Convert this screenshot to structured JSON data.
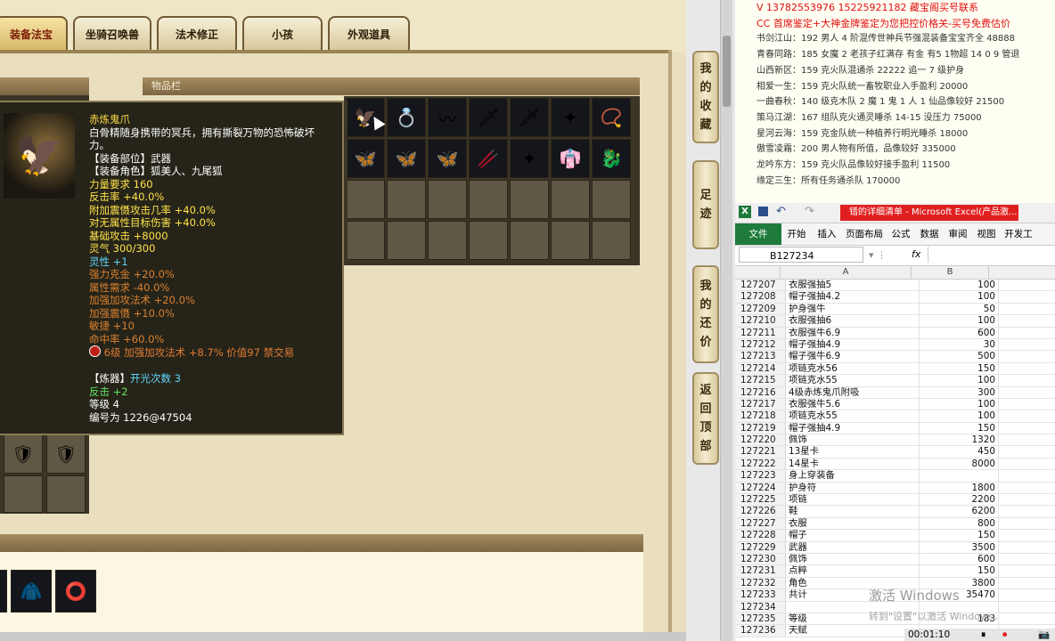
{
  "game": {
    "tabs": [
      {
        "label": "装备法宝",
        "active": true
      },
      {
        "label": "坐骑召唤兽",
        "active": false
      },
      {
        "label": "法术修正",
        "active": false
      },
      {
        "label": "小孩",
        "active": false
      },
      {
        "label": "外观道具",
        "active": false
      }
    ],
    "inventory_header": "物品栏",
    "inventory_row1_icons": [
      "🦅",
      "💍",
      "〰",
      "🗡",
      "🗡",
      "✦",
      "📿"
    ],
    "inventory_row2_icons": [
      "🦋",
      "🦋",
      "🦋",
      "🥢",
      "✦",
      "👘",
      "🐉"
    ],
    "tooltip": {
      "name": "赤炼鬼爪",
      "desc_line1": "白骨精随身携带的冥兵，拥有撕裂万物的恐怖破坏",
      "desc_line2": "力。",
      "slot": "【装备部位】武器",
      "role": "【装备角色】狐美人、九尾狐",
      "stats_yellow": [
        "力量要求 160",
        "反击率 +40.0%",
        "附加震慑攻击几率 +40.0%",
        "对无属性目标伤害 +40.0%",
        "基础攻击 +8000",
        "灵气 300/300"
      ],
      "spirit": "灵性 +1",
      "stats_orange": [
        "强力克金 +20.0%",
        "属性需求 -40.0%",
        "加强加攻法术 +20.0%",
        "加强震慑 +10.0%",
        "敏捷 +10",
        "命中率 +60.0%"
      ],
      "gem_line": "6级 加强加攻法术 +8.7% 价值97 禁交易",
      "refiner_label": "【炼器】",
      "refiner_value": "开光次数 3",
      "counter": "反击 +2",
      "level": "等级 4",
      "serial": "编号为 1226@47504"
    }
  },
  "side_nav": [
    {
      "label": "我的收藏"
    },
    {
      "label": "足迹"
    },
    {
      "label": "我的还价"
    },
    {
      "label": "返回顶部"
    }
  ],
  "notes": {
    "line1": "V 13782553976    15225921182   藏宝阁买号联系",
    "line2": "CC 首席鉴定+大神金牌鉴定为您把控价格关-买号免费估价",
    "entries": [
      "书剑江山：192 男人 4 阶混传世神兵节强混装备宝宝齐全 48888",
      "青春同路：185 女魔 2 老孩子红满存 有金 有5 1物超 14 0 9 管退",
      "山西新区：159 克火队混通杀 22222 追一 7 级护身",
      "相爱一生：159 克火队统一畜牧职业入手盈利 20000",
      "一曲春秋：140 级克木队 2 魔 1 鬼 1 人 1 仙品像较好 21500",
      "策马江湖：167 组队克火通灵睡杀 14-15 没压力 75000",
      "星河云海：159 克金队统一种植养行明光睡杀 18000",
      "傲雪凌霜：200 男人物有所值，品像较好 335000",
      "龙吟东方：159 克火队品像较好接手盈利 11500",
      "缘定三生：所有任务通杀队 170000"
    ]
  },
  "excel": {
    "title": "错的详细清单 - Microsoft Excel(产品激...",
    "file_tab": "文件",
    "ribbon": [
      "开始",
      "插入",
      "页面布局",
      "公式",
      "数据",
      "审阅",
      "视图",
      "开发工"
    ],
    "name_box": "B127234",
    "fx": "fx",
    "col_a": "A",
    "col_b": "B",
    "rows": [
      {
        "r": "127207",
        "a": "衣服强抽5",
        "b": "100"
      },
      {
        "r": "127208",
        "a": "帽子强抽4.2",
        "b": "100"
      },
      {
        "r": "127209",
        "a": "护身强牛",
        "b": "50"
      },
      {
        "r": "127210",
        "a": "衣服强抽6",
        "b": "100"
      },
      {
        "r": "127211",
        "a": "衣服强牛6.9",
        "b": "600"
      },
      {
        "r": "127212",
        "a": "帽子强抽4.9",
        "b": "30"
      },
      {
        "r": "127213",
        "a": "帽子强牛6.9",
        "b": "500"
      },
      {
        "r": "127214",
        "a": "项链克水56",
        "b": "150"
      },
      {
        "r": "127215",
        "a": "项链克水55",
        "b": "100"
      },
      {
        "r": "127216",
        "a": "4级赤炼鬼爪附吸",
        "b": "300"
      },
      {
        "r": "127217",
        "a": "衣服强牛5.6",
        "b": "100"
      },
      {
        "r": "127218",
        "a": "项链克水55",
        "b": "100"
      },
      {
        "r": "127219",
        "a": "帽子强抽4.9",
        "b": "150"
      },
      {
        "r": "127220",
        "a": "佩饰",
        "b": "1320"
      },
      {
        "r": "127221",
        "a": "13星卡",
        "b": "450"
      },
      {
        "r": "127222",
        "a": "14星卡",
        "b": "8000"
      },
      {
        "r": "127223",
        "a": "身上穿装备",
        "b": ""
      },
      {
        "r": "127224",
        "a": "护身符",
        "b": "1800"
      },
      {
        "r": "127225",
        "a": "项链",
        "b": "2200"
      },
      {
        "r": "127226",
        "a": "鞋",
        "b": "6200"
      },
      {
        "r": "127227",
        "a": "衣服",
        "b": "800"
      },
      {
        "r": "127228",
        "a": "帽子",
        "b": "150"
      },
      {
        "r": "127229",
        "a": "武器",
        "b": "3500"
      },
      {
        "r": "127230",
        "a": "佩饰",
        "b": "600"
      },
      {
        "r": "127231",
        "a": "点粹",
        "b": "150"
      },
      {
        "r": "127232",
        "a": "角色",
        "b": "3800"
      },
      {
        "r": "127233",
        "a": "共计",
        "b": "35470"
      },
      {
        "r": "127234",
        "a": "",
        "b": ""
      },
      {
        "r": "127235",
        "a": "等级",
        "b": "183"
      },
      {
        "r": "127236",
        "a": "天赋",
        "b": ""
      }
    ],
    "watermark1": "激活 Windows",
    "watermark2": "转到\"设置\"以激活 Windows。",
    "timer": "00:01:10"
  }
}
